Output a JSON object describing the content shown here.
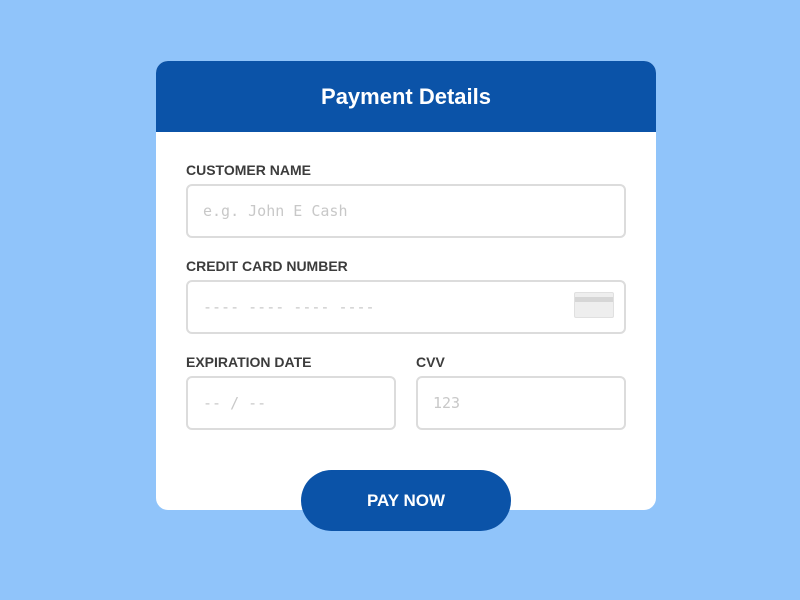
{
  "header": {
    "title": "Payment Details"
  },
  "form": {
    "customer_name": {
      "label": "CUSTOMER NAME",
      "placeholder": "e.g. John E Cash",
      "value": ""
    },
    "card_number": {
      "label": "CREDIT CARD NUMBER",
      "placeholder": "---- ---- ---- ----",
      "value": "",
      "icon": "credit-card-icon"
    },
    "expiration": {
      "label": "EXPIRATION DATE",
      "placeholder": "-- / --",
      "value": ""
    },
    "cvv": {
      "label": "CVV",
      "placeholder": "123",
      "value": ""
    }
  },
  "actions": {
    "pay_label": "PAY NOW"
  },
  "colors": {
    "background": "#90c4fa",
    "accent": "#0b53a8",
    "card": "#ffffff",
    "label": "#3c3c3c",
    "input_border": "#dcdcdc",
    "placeholder": "#c8c8c8"
  }
}
